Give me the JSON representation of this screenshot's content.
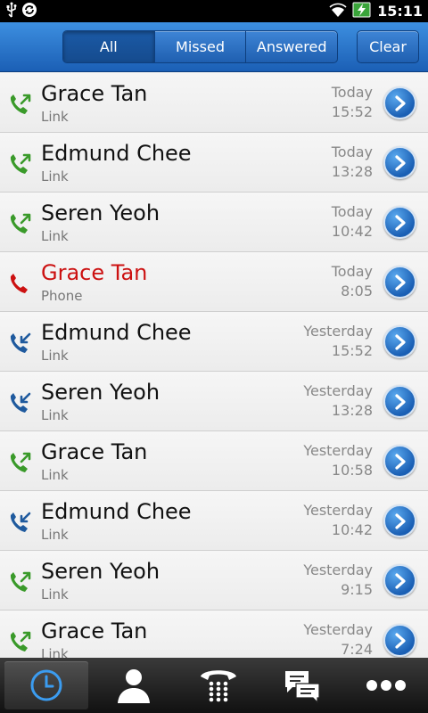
{
  "status_bar": {
    "time": "15:11",
    "left_icons": [
      "usb-icon",
      "sync-icon"
    ],
    "right_icons": [
      "wifi-icon",
      "battery-charging-icon"
    ]
  },
  "header": {
    "filters": [
      {
        "label": "All",
        "active": true
      },
      {
        "label": "Missed",
        "active": false
      },
      {
        "label": "Answered",
        "active": false
      }
    ],
    "clear_label": "Clear"
  },
  "calls": [
    {
      "name": "Grace Tan",
      "type": "Link",
      "day": "Today",
      "time": "15:52",
      "call_kind": "outgoing"
    },
    {
      "name": "Edmund Chee",
      "type": "Link",
      "day": "Today",
      "time": "13:28",
      "call_kind": "outgoing"
    },
    {
      "name": "Seren Yeoh",
      "type": "Link",
      "day": "Today",
      "time": "10:42",
      "call_kind": "outgoing"
    },
    {
      "name": "Grace Tan",
      "type": "Phone",
      "day": "Today",
      "time": "8:05",
      "call_kind": "missed"
    },
    {
      "name": "Edmund Chee",
      "type": "Link",
      "day": "Yesterday",
      "time": "15:52",
      "call_kind": "incoming"
    },
    {
      "name": "Seren Yeoh",
      "type": "Link",
      "day": "Yesterday",
      "time": "13:28",
      "call_kind": "incoming"
    },
    {
      "name": "Grace Tan",
      "type": "Link",
      "day": "Yesterday",
      "time": "10:58",
      "call_kind": "outgoing"
    },
    {
      "name": "Edmund Chee",
      "type": "Link",
      "day": "Yesterday",
      "time": "10:42",
      "call_kind": "incoming"
    },
    {
      "name": "Seren Yeoh",
      "type": "Link",
      "day": "Yesterday",
      "time": "9:15",
      "call_kind": "outgoing"
    },
    {
      "name": "Grace Tan",
      "type": "Link",
      "day": "Yesterday",
      "time": "7:24",
      "call_kind": "outgoing"
    }
  ],
  "bottom_tabs": [
    {
      "icon": "clock-icon",
      "active": true
    },
    {
      "icon": "contact-icon",
      "active": false
    },
    {
      "icon": "dialpad-icon",
      "active": false
    },
    {
      "icon": "chat-icon",
      "active": false
    },
    {
      "icon": "more-icon",
      "active": false
    }
  ],
  "colors": {
    "outgoing": "#3a9a2a",
    "incoming": "#1f5a9e",
    "missed": "#cc1111",
    "header_blue": "#2a70c8"
  }
}
